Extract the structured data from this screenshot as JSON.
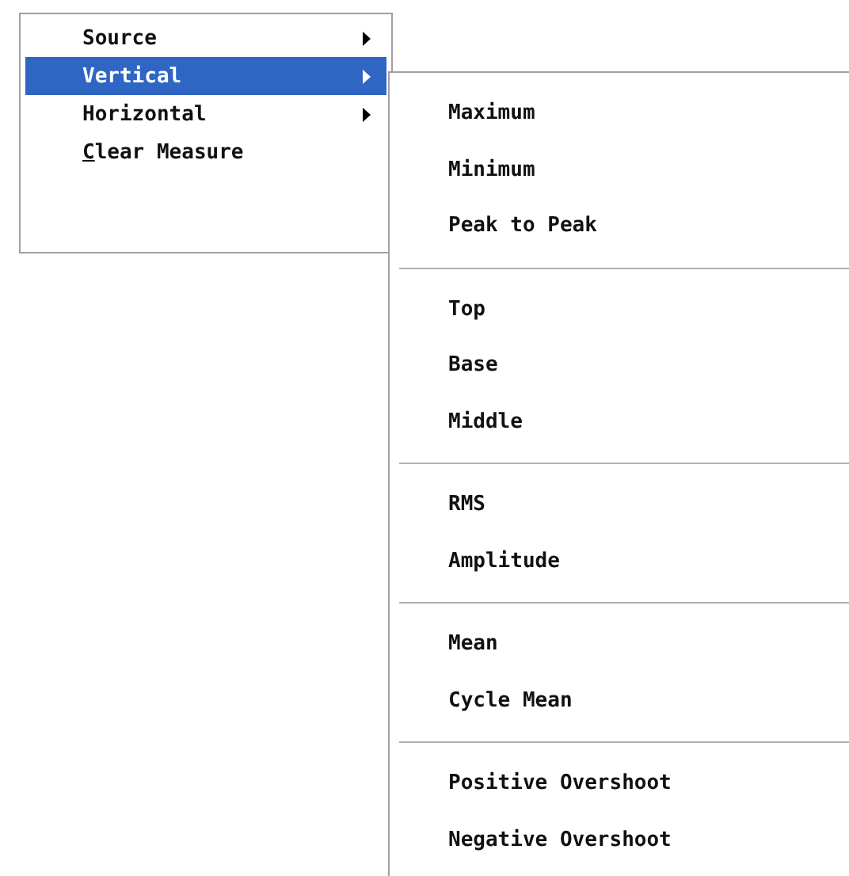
{
  "menu": {
    "items": [
      {
        "label": "Source",
        "selected": false,
        "has_submenu": true,
        "mnemonic": false
      },
      {
        "label": "Vertical",
        "selected": true,
        "has_submenu": true,
        "mnemonic": false
      },
      {
        "label": "Horizontal",
        "selected": false,
        "has_submenu": true,
        "mnemonic": false
      },
      {
        "label": "Clear Measure",
        "selected": false,
        "has_submenu": false,
        "mnemonic": true
      }
    ]
  },
  "submenu": {
    "groups": [
      {
        "items": [
          "Maximum",
          "Minimum",
          "Peak to Peak"
        ]
      },
      {
        "items": [
          "Top",
          "Base",
          "Middle"
        ]
      },
      {
        "items": [
          "RMS",
          "Amplitude"
        ]
      },
      {
        "items": [
          "Mean",
          "Cycle Mean"
        ]
      },
      {
        "items": [
          "Positive Overshoot",
          "Negative Overshoot"
        ]
      }
    ]
  }
}
